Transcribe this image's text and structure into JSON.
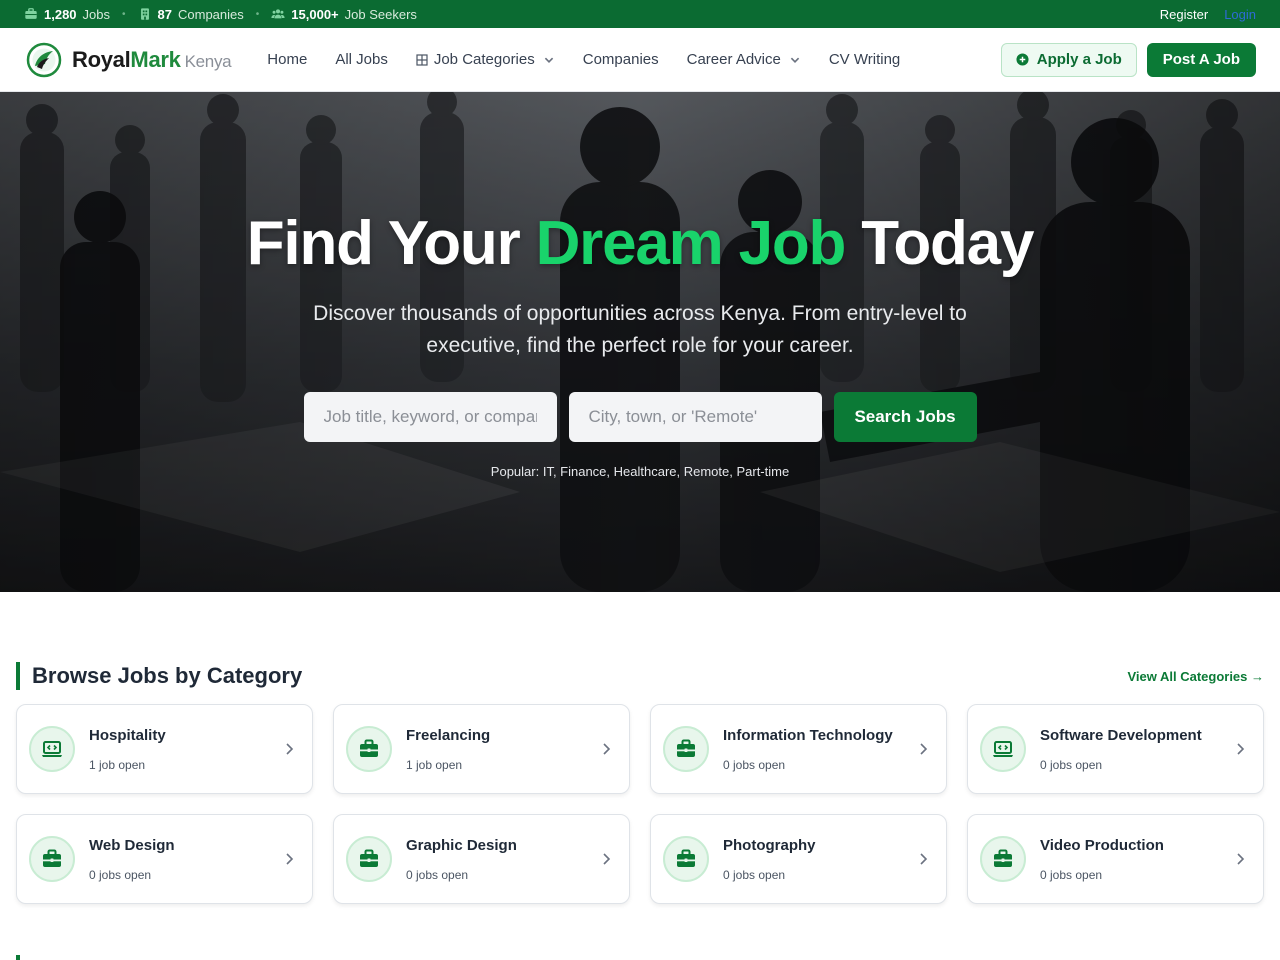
{
  "topbar": {
    "stats": [
      {
        "icon": "briefcase-icon",
        "value": "1,280",
        "label": "Jobs"
      },
      {
        "icon": "building-icon",
        "value": "87",
        "label": "Companies"
      },
      {
        "icon": "users-icon",
        "value": "15,000+",
        "label": "Job Seekers"
      }
    ],
    "register": "Register",
    "login": "Login"
  },
  "header": {
    "brand_royal": "Royal",
    "brand_mark": "Mark",
    "brand_country": "Kenya",
    "nav": [
      "Home",
      "All Jobs",
      "Job Categories",
      "Companies",
      "Career Advice",
      "CV Writing"
    ],
    "apply_label": "Apply a Job",
    "post_label": "Post A Job"
  },
  "hero": {
    "title_start": "Find Your ",
    "title_accent": "Dream Job",
    "title_end": " Today",
    "subtitle": "Discover thousands of opportunities across Kenya. From entry-level to executive, find the perfect role for your career.",
    "keyword_placeholder": "Job title, keyword, or company",
    "location_placeholder": "City, town, or 'Remote'",
    "search_label": "Search Jobs",
    "popular": "Popular: IT, Finance, Healthcare, Remote, Part-time"
  },
  "categories": {
    "title": "Browse Jobs by Category",
    "view_all": "View All Categories →",
    "items": [
      {
        "name": "Hospitality",
        "count": "1 job open",
        "icon": "laptop-code-icon"
      },
      {
        "name": "Freelancing",
        "count": "1 job open",
        "icon": "briefcase-icon"
      },
      {
        "name": "Information Technology",
        "count": "0 jobs open",
        "icon": "briefcase-icon"
      },
      {
        "name": "Software Development",
        "count": "0 jobs open",
        "icon": "laptop-code-icon"
      },
      {
        "name": "Web Design",
        "count": "0 jobs open",
        "icon": "briefcase-icon"
      },
      {
        "name": "Graphic Design",
        "count": "0 jobs open",
        "icon": "briefcase-icon"
      },
      {
        "name": "Photography",
        "count": "0 jobs open",
        "icon": "briefcase-icon"
      },
      {
        "name": "Video Production",
        "count": "0 jobs open",
        "icon": "briefcase-icon"
      }
    ]
  },
  "colors": {
    "brand_green": "#0b7a36",
    "topbar_green": "#0b6b32",
    "accent_green": "#19d36b"
  }
}
